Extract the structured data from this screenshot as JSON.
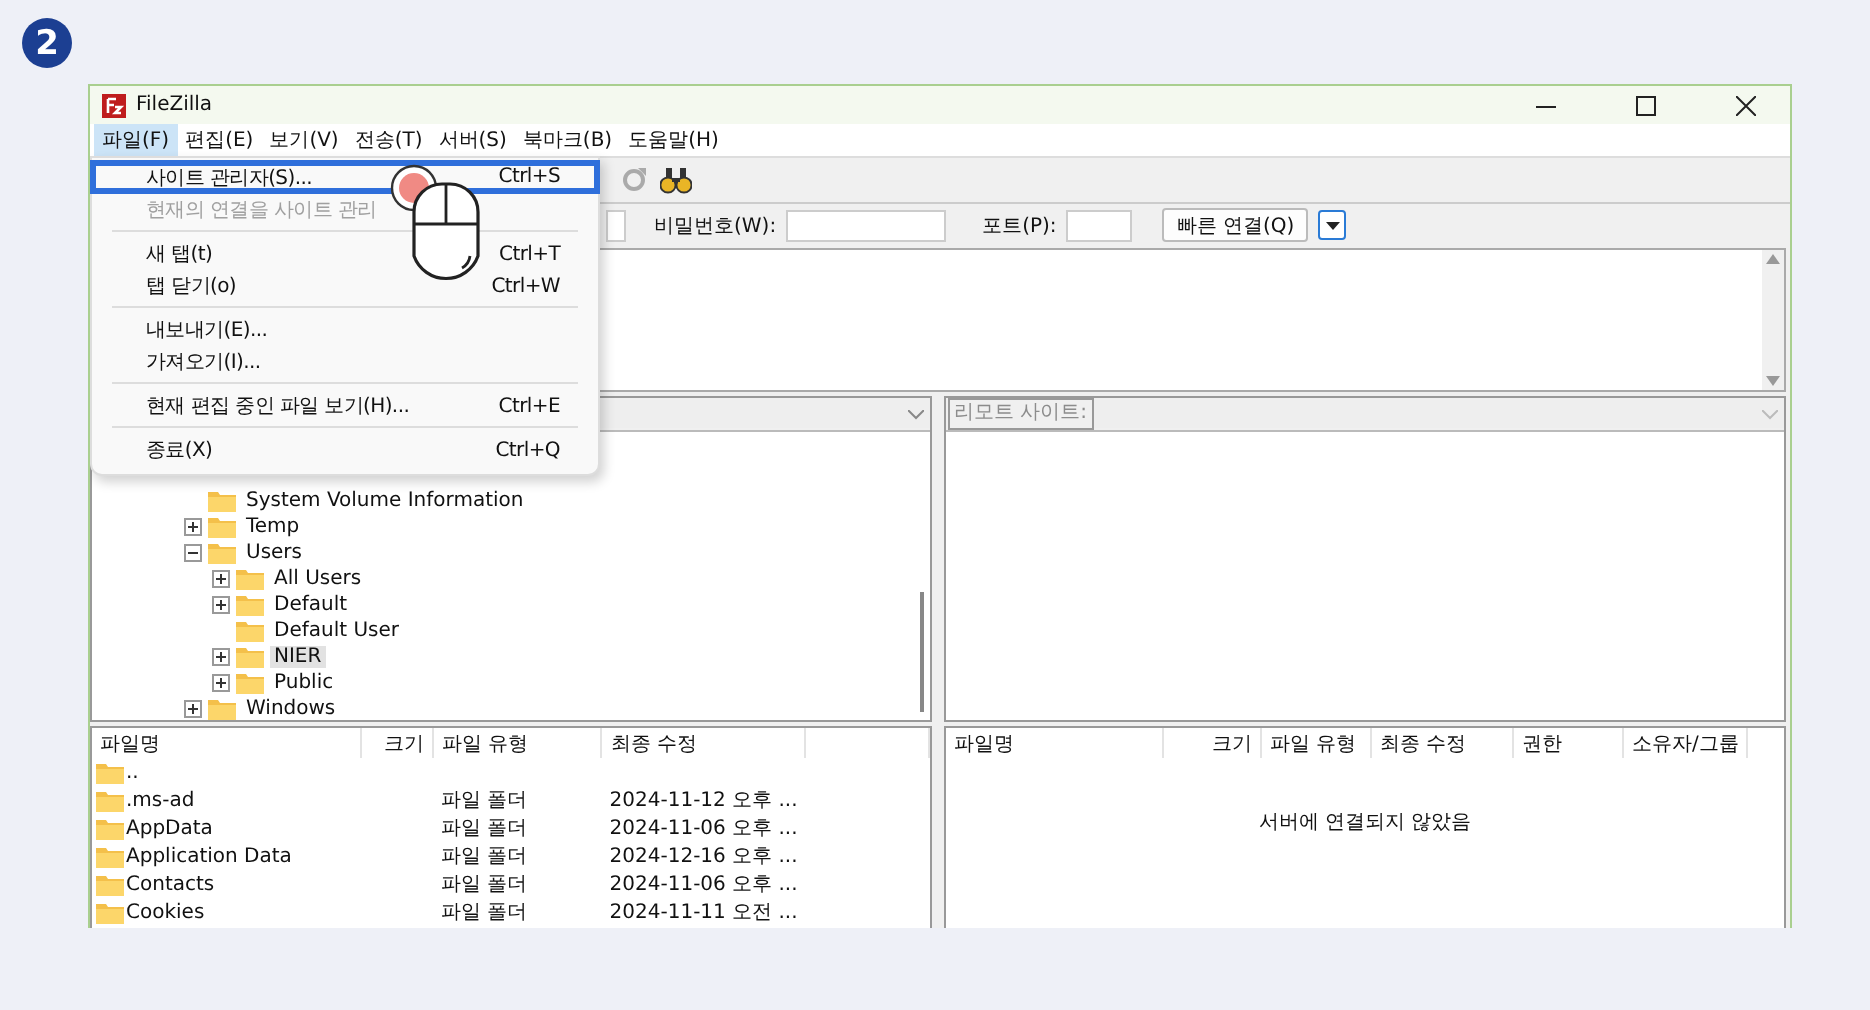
{
  "step_badge": "2",
  "window": {
    "title": "FileZilla"
  },
  "menu_bar": [
    {
      "label": "파일(F)",
      "selected": true
    },
    {
      "label": "편집(E)",
      "selected": false
    },
    {
      "label": "보기(V)",
      "selected": false
    },
    {
      "label": "전송(T)",
      "selected": false
    },
    {
      "label": "서버(S)",
      "selected": false
    },
    {
      "label": "북마크(B)",
      "selected": false
    },
    {
      "label": "도움말(H)",
      "selected": false
    }
  ],
  "file_menu": [
    {
      "kind": "item",
      "label": "사이트 관리자(S)...",
      "shortcut": "Ctrl+S",
      "selected": true,
      "disabled": false
    },
    {
      "kind": "item",
      "label": "현재의 연결을 사이트 관리",
      "selected": false,
      "disabled": true
    },
    {
      "kind": "separator"
    },
    {
      "kind": "item",
      "label": "새 탭(t)",
      "shortcut": "Ctrl+T",
      "selected": false,
      "disabled": false
    },
    {
      "kind": "item",
      "label": "탭 닫기(o)",
      "shortcut": "Ctrl+W",
      "selected": false,
      "disabled": false
    },
    {
      "kind": "separator"
    },
    {
      "kind": "item",
      "label": "내보내기(E)...",
      "selected": false,
      "disabled": false
    },
    {
      "kind": "item",
      "label": "가져오기(I)...",
      "selected": false,
      "disabled": false
    },
    {
      "kind": "separator"
    },
    {
      "kind": "item",
      "label": "현재 편집 중인 파일 보기(H)...",
      "shortcut": "Ctrl+E",
      "selected": false,
      "disabled": false
    },
    {
      "kind": "separator"
    },
    {
      "kind": "item",
      "label": "종료(X)",
      "shortcut": "Ctrl+Q",
      "selected": false,
      "disabled": false
    }
  ],
  "quickconnect": {
    "password_label": "비밀번호(W):",
    "port_label": "포트(P):",
    "connect_button": "빠른 연결(Q)"
  },
  "remote_site": {
    "label": "리모트 사이트:"
  },
  "local_tree": [
    {
      "label": "System Volume Information",
      "selected": false
    },
    {
      "label": "Temp",
      "expanded": false,
      "selected": false
    },
    {
      "label": "Users",
      "expanded": true,
      "selected": false,
      "children": [
        {
          "label": "All Users",
          "expanded": false,
          "selected": false
        },
        {
          "label": "Default",
          "expanded": false,
          "selected": false
        },
        {
          "label": "Default User",
          "selected": false
        },
        {
          "label": "NIER",
          "expanded": false,
          "selected": true
        },
        {
          "label": "Public",
          "expanded": false,
          "selected": false
        }
      ]
    },
    {
      "label": "Windows",
      "expanded": false,
      "selected": false
    }
  ],
  "local_files": {
    "columns": [
      "파일명",
      "크기",
      "파일 유형",
      "최종 수정"
    ],
    "rows": [
      {
        "name": ".."
      },
      {
        "name": ".ms-ad",
        "type": "파일 폴더",
        "modified": "2024-11-12 오후 ..."
      },
      {
        "name": "AppData",
        "type": "파일 폴더",
        "modified": "2024-11-06 오후 ..."
      },
      {
        "name": "Application Data",
        "type": "파일 폴더",
        "modified": "2024-12-16 오후 ..."
      },
      {
        "name": "Contacts",
        "type": "파일 폴더",
        "modified": "2024-11-06 오후 ..."
      },
      {
        "name": "Cookies",
        "type": "파일 폴더",
        "modified": "2024-11-11 오전 ..."
      }
    ]
  },
  "remote_files": {
    "columns": [
      "파일명",
      "크기",
      "파일 유형",
      "최종 수정",
      "권한",
      "소유자/그룹"
    ],
    "empty_message": "서버에 연결되지 않았음"
  }
}
